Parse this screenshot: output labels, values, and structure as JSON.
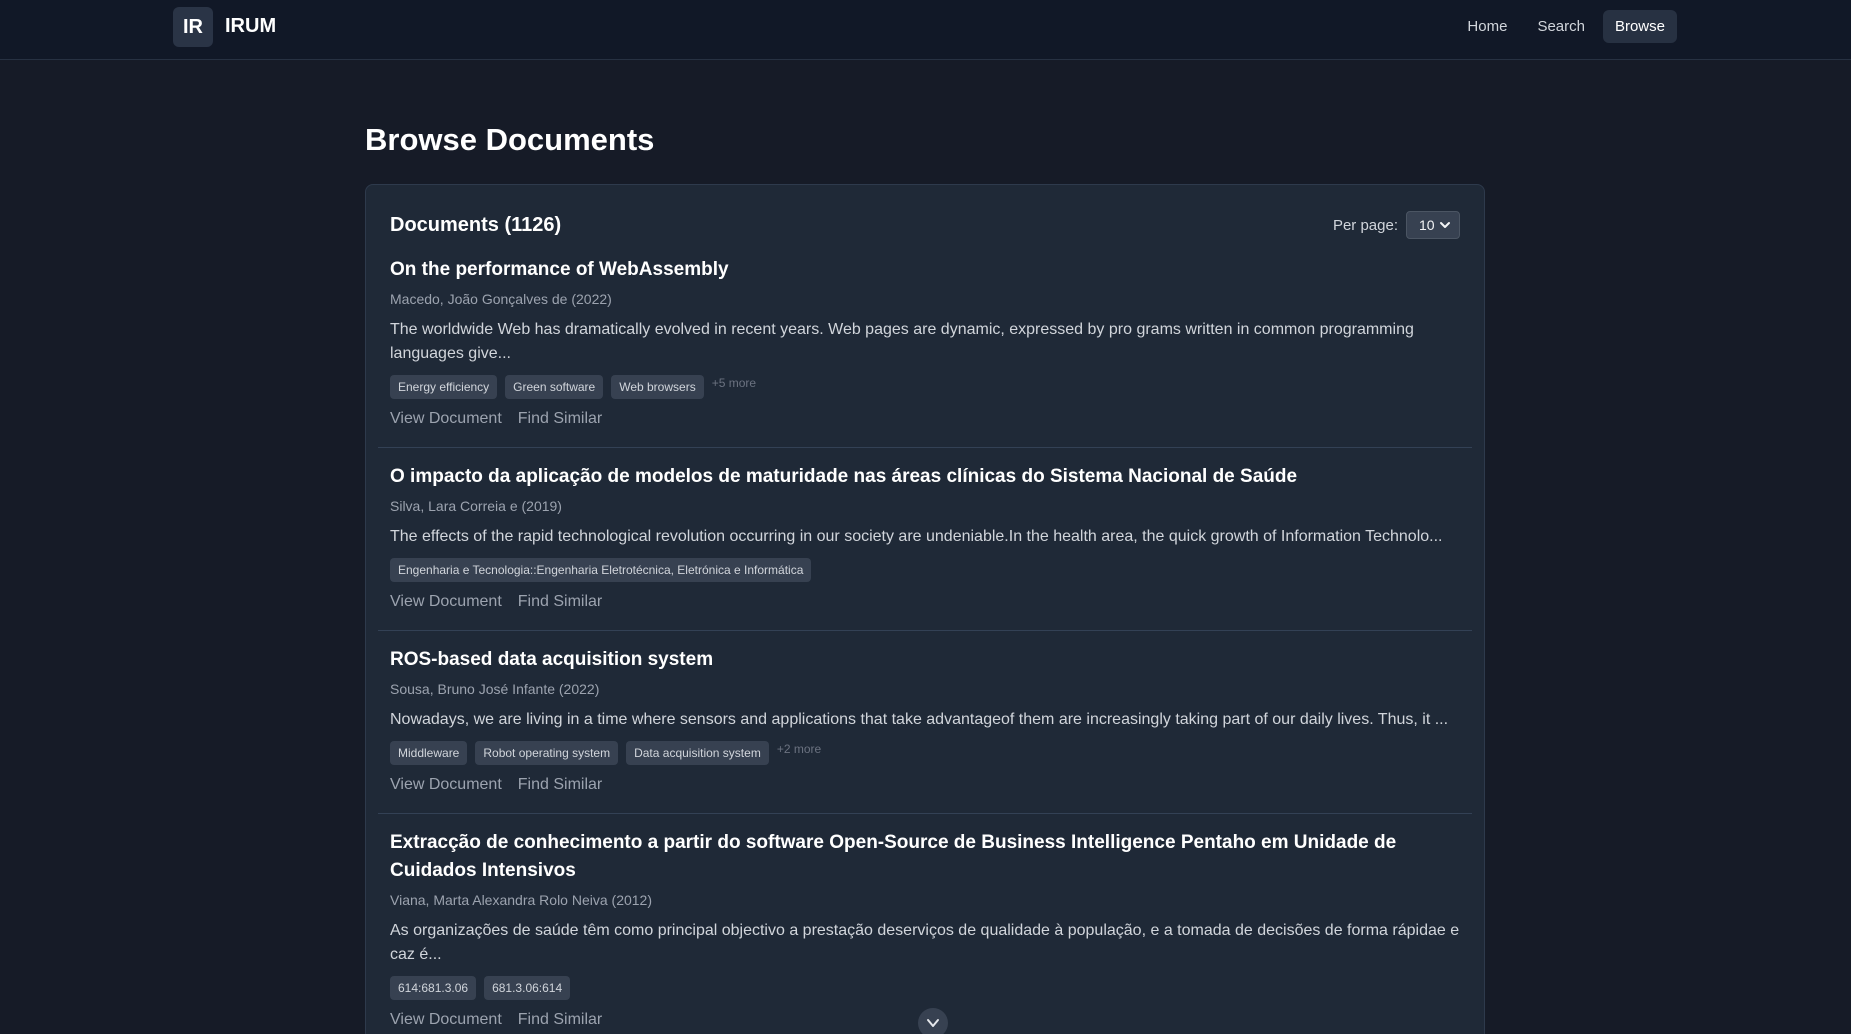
{
  "header": {
    "logo_text": "IR",
    "brand": "IRUM",
    "nav": [
      {
        "label": "Home"
      },
      {
        "label": "Search"
      },
      {
        "label": "Browse"
      }
    ]
  },
  "page": {
    "title": "Browse Documents"
  },
  "list": {
    "title": "Documents (1126)",
    "per_page_label": "Per page:",
    "per_page_value": "10"
  },
  "actions": {
    "view": "View Document",
    "similar": "Find Similar"
  },
  "documents": [
    {
      "title": "On the performance of WebAssembly",
      "meta": "Macedo, João Gonçalves de (2022)",
      "abstract": "The worldwide Web has dramatically evolved in recent years. Web pages are dynamic, expressed by pro grams written in common programming languages give...",
      "tags": [
        "Energy efficiency",
        "Green software",
        "Web browsers"
      ],
      "more": "+5 more"
    },
    {
      "title": "O impacto da aplicação de modelos de maturidade nas áreas clínicas do Sistema Nacional de Saúde",
      "meta": "Silva, Lara Correia e (2019)",
      "abstract": "The effects of the rapid technological revolution occurring in our society are undeniable.In the health area, the quick growth of Information Technolo...",
      "tags": [
        "Engenharia e Tecnologia::Engenharia Eletrotécnica, Eletrónica e Informática"
      ],
      "more": ""
    },
    {
      "title": "ROS-based data acquisition system",
      "meta": "Sousa, Bruno José Infante (2022)",
      "abstract": "Nowadays, we are living in a time where sensors and applications that take advantageof them are increasingly taking part of our daily lives. Thus, it ...",
      "tags": [
        "Middleware",
        "Robot operating system",
        "Data acquisition system"
      ],
      "more": "+2 more"
    },
    {
      "title": "Extracção de conhecimento a partir do software Open-Source de Business Intelligence Pentaho em Unidade de Cuidados Intensivos",
      "meta": "Viana, Marta Alexandra Rolo Neiva (2012)",
      "abstract": "As organizações de saúde têm como principal objectivo a prestação deserviços de qualidade à população, e a tomada de decisões de forma rápidae e caz é...",
      "tags": [
        "614:681.3.06",
        "681.3.06:614"
      ],
      "more": ""
    }
  ]
}
